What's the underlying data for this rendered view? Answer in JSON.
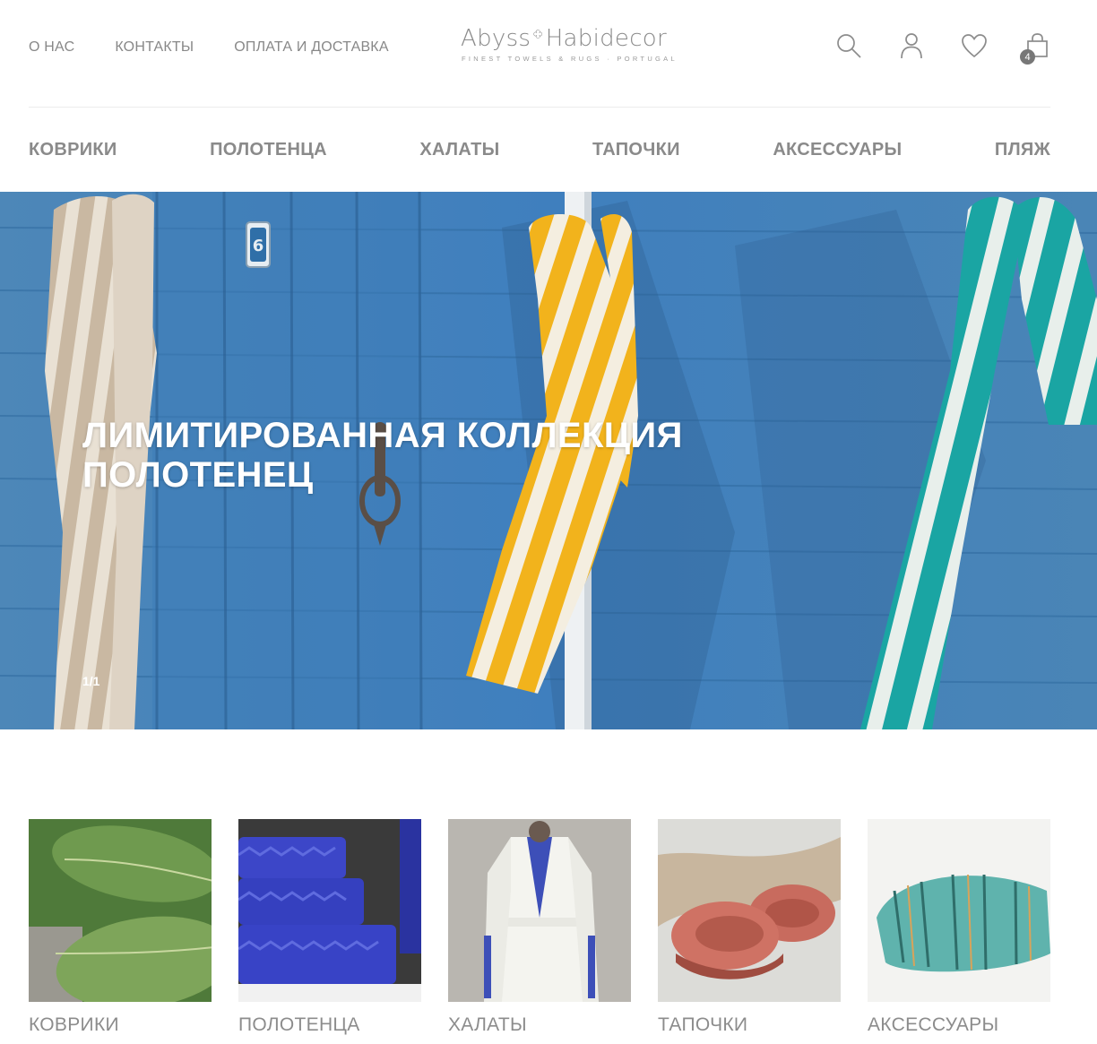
{
  "header": {
    "links": [
      {
        "id": "about",
        "label": "О НАС"
      },
      {
        "id": "contacts",
        "label": "КОНТАКТЫ"
      },
      {
        "id": "payment",
        "label": "ОПЛАТА И ДОСТАВКА"
      }
    ],
    "logo": {
      "left_word": "Abyss",
      "right_word": "Habidecor",
      "tagline": "FINEST TOWELS & RUGS · PORTUGAL"
    },
    "icons": [
      "search-icon",
      "user-icon",
      "heart-icon",
      "bag-icon"
    ],
    "cart_count": "4"
  },
  "nav": {
    "items": [
      {
        "id": "rugs",
        "label": "КОВРИКИ"
      },
      {
        "id": "towels",
        "label": "ПОЛОТЕНЦА"
      },
      {
        "id": "robes",
        "label": "ХАЛАТЫ"
      },
      {
        "id": "slippers",
        "label": "ТАПОЧКИ"
      },
      {
        "id": "accessories",
        "label": "АКСЕССУАРЫ"
      },
      {
        "id": "beach",
        "label": "ПЛЯЖ"
      }
    ]
  },
  "hero": {
    "title_line1": "ЛИМИТИРОВАННАЯ КОЛЛЕКЦИЯ",
    "title_line2": "ПОЛОТЕНЕЦ",
    "counter": "1/1",
    "door_number": "6"
  },
  "tiles": [
    {
      "id": "rugs",
      "label": "КОВРИКИ"
    },
    {
      "id": "towels",
      "label": "ПОЛОТЕНЦА"
    },
    {
      "id": "robes",
      "label": "ХАЛАТЫ"
    },
    {
      "id": "slippers",
      "label": "ТАПОЧКИ"
    },
    {
      "id": "accessories",
      "label": "АКСЕССУАРЫ"
    }
  ],
  "colors": {
    "text_gray": "#888888",
    "wall_blue": "#3f7db6",
    "towel_yellow": "#f2b31c",
    "towel_teal": "#1aa5a3",
    "towel_beige": "#cdbca6"
  }
}
